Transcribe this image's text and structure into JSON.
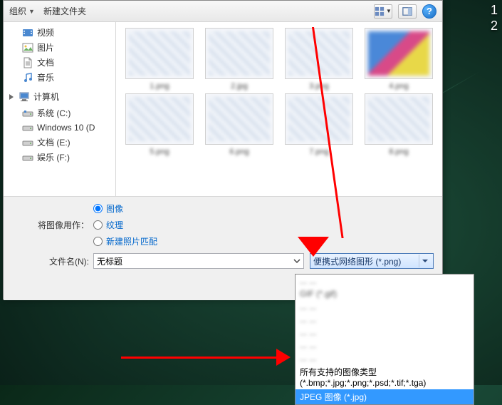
{
  "toolbar": {
    "organize": "组织",
    "new_folder": "新建文件夹"
  },
  "sidebar": {
    "libraries": [
      {
        "label": "视频",
        "icon": "video-icon"
      },
      {
        "label": "图片",
        "icon": "image-icon"
      },
      {
        "label": "文档",
        "icon": "document-icon"
      },
      {
        "label": "音乐",
        "icon": "music-icon"
      }
    ],
    "computer_label": "计算机",
    "drives": [
      {
        "label": "系统 (C:)",
        "icon": "drive-icon"
      },
      {
        "label": "Windows 10 (D",
        "icon": "drive-icon"
      },
      {
        "label": "文档 (E:)",
        "icon": "drive-icon"
      },
      {
        "label": "娱乐 (F:)",
        "icon": "drive-icon"
      }
    ]
  },
  "files": [
    {
      "name": "1.png"
    },
    {
      "name": "2.jpg"
    },
    {
      "name": "3.png"
    },
    {
      "name": "4.png"
    },
    {
      "name": "5.png"
    },
    {
      "name": "6.png"
    },
    {
      "name": "7.png"
    },
    {
      "name": "8.png"
    }
  ],
  "use_as": {
    "label": "将图像用作：",
    "options": {
      "image": "图像",
      "texture": "纹理",
      "new_photo_match": "新建照片匹配"
    },
    "selected": "image"
  },
  "filename": {
    "label": "文件名(N):",
    "value": "无标题"
  },
  "filetype": {
    "selected": "便携式网络图形 (*.png)",
    "options_blurred": [
      "... ...",
      "GIF (*.gif)",
      "... ...",
      "... ...",
      "... ...",
      "... ...",
      "... ..."
    ],
    "option_all": "所有支持的图像类型 (*.bmp;*.jpg;*.png;*.psd;*.tif;*.tga)",
    "option_jpeg": "JPEG 图像 (*.jpg)"
  },
  "desktop": {
    "time1": "1",
    "time2": "2"
  }
}
